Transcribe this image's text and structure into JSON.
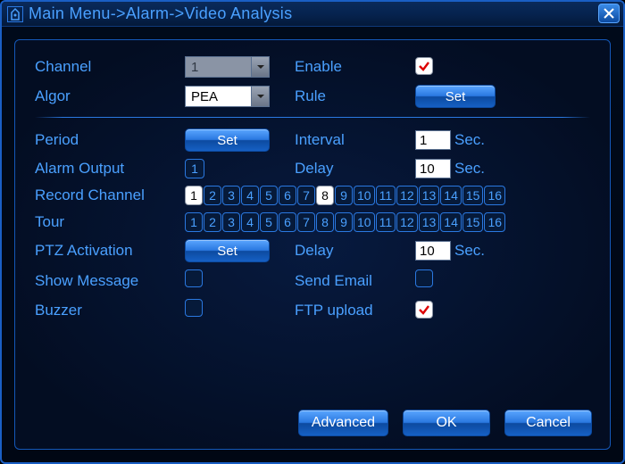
{
  "title": "Main Menu->Alarm->Video Analysis",
  "labels": {
    "channel": "Channel",
    "enable": "Enable",
    "algor": "Algor",
    "rule": "Rule",
    "period": "Period",
    "interval": "Interval",
    "alarm_output": "Alarm Output",
    "delay": "Delay",
    "record_channel": "Record Channel",
    "tour": "Tour",
    "ptz_activation": "PTZ Activation",
    "ptz_delay": "Delay",
    "show_message": "Show Message",
    "send_email": "Send Email",
    "buzzer": "Buzzer",
    "ftp_upload": "FTP upload"
  },
  "buttons": {
    "set_rule": "Set",
    "set_period": "Set",
    "set_ptz": "Set",
    "advanced": "Advanced",
    "ok": "OK",
    "cancel": "Cancel"
  },
  "values": {
    "channel": "1",
    "algor": "PEA",
    "interval": "1",
    "alarm_output": "1",
    "delay": "10",
    "ptz_delay": "10",
    "sec_unit": "Sec."
  },
  "checkboxes": {
    "enable": true,
    "show_message": false,
    "send_email": false,
    "buzzer": false,
    "ftp_upload": true
  },
  "channels": {
    "list": [
      "1",
      "2",
      "3",
      "4",
      "5",
      "6",
      "7",
      "8",
      "9",
      "10",
      "11",
      "12",
      "13",
      "14",
      "15",
      "16"
    ],
    "record_selected": [
      "1",
      "8"
    ],
    "tour_selected": []
  }
}
